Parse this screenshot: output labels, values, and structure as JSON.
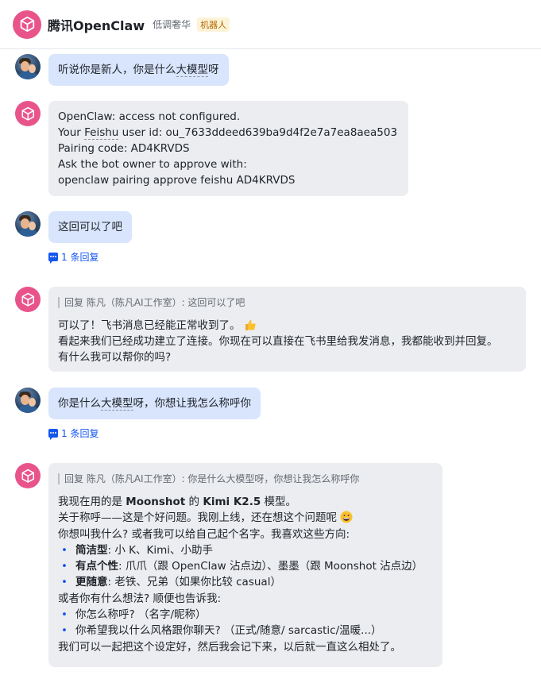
{
  "header": {
    "title": "腾讯OpenClaw",
    "subtitle": "低调奢华",
    "tag": "机器人"
  },
  "messages": {
    "m1": {
      "text_pre": "听说你是新人，你是什么",
      "text_u": "大模型",
      "text_post": "呀"
    },
    "m2": {
      "l1": "OpenClaw: access not configured.",
      "l2_pre": "Your ",
      "l2_u": "Feishu",
      "l2_post": " user id: ou_7633ddeed639ba9d4f2e7a7ea8aea503",
      "l3": "Pairing code: AD4KRVDS",
      "l4": "Ask the bot owner to approve with:",
      "l5": "openclaw pairing approve feishu AD4KRVDS"
    },
    "m3": {
      "text": "这回可以了吧",
      "reply_count": "1 条回复"
    },
    "m4": {
      "quote": "回复 陈凡（陈凡AI工作室）: 这回可以了吧",
      "l1": "可以了！飞书消息已经能正常收到了。",
      "l2": "看起来我们已经成功建立了连接。你现在可以直接在飞书里给我发消息，我都能收到并回复。",
      "l3": "有什么我可以帮你的吗?"
    },
    "m5": {
      "text_pre": "你是什么",
      "text_u": "大模型",
      "text_post": "呀，你想让我怎么称呼你",
      "reply_count": "1 条回复"
    },
    "m6": {
      "quote": "回复 陈凡（陈凡AI工作室）: 你是什么大模型呀，你想让我怎么称呼你",
      "l1_pre": "我现在用的是 ",
      "l1_b1": "Moonshot",
      "l1_mid": " 的 ",
      "l1_b2": "Kimi K2.5",
      "l1_post": " 模型。",
      "l2": "关于称呼——这是个好问题。我刚上线，还在想这个问题呢",
      "l3": "你想叫我什么? 或者我可以给自己起个名字。我喜欢这些方向:",
      "b1_b": "简洁型",
      "b1_t": ": 小 K、Kimi、小助手",
      "b2_b": "有点个性",
      "b2_t": ": 爪爪（跟 OpenClaw 沾点边）、墨墨（跟 Moonshot 沾点边）",
      "b3_b": "更随意",
      "b3_t": ": 老铁、兄弟（如果你比较 casual）",
      "l4": "或者你有什么想法? 顺便也告诉我:",
      "b4": "你怎么称呼? （名字/昵称）",
      "b5": "你希望我以什么风格跟你聊天? （正式/随意/ sarcastic/温暖...）",
      "l5": "我们可以一起把这个设定好，然后我会记下来，以后就一直这么相处了。"
    }
  },
  "colors": {
    "bot_avatar": "#e8548a",
    "user_bubble": "#d8e5fd",
    "bot_bubble": "#ebedf0",
    "link": "#1456f0"
  }
}
